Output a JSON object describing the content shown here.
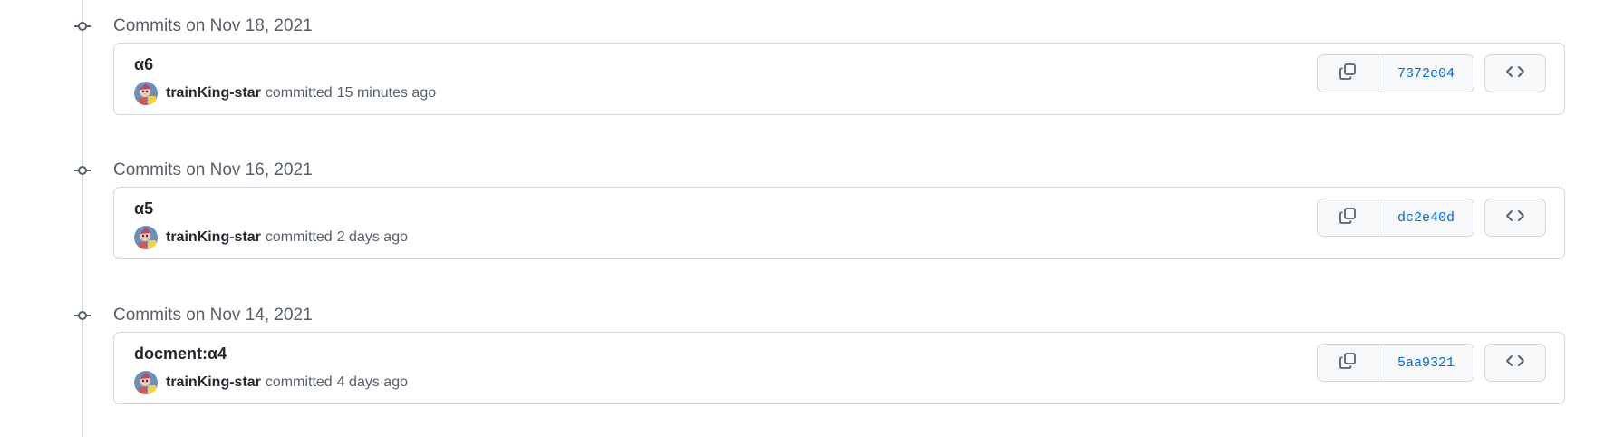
{
  "groups": [
    {
      "title": "Commits on Nov 18, 2021",
      "commit": {
        "message": "α6",
        "author": "trainKing-star",
        "action": "committed",
        "time": "15 minutes ago",
        "sha": "7372e04"
      }
    },
    {
      "title": "Commits on Nov 16, 2021",
      "commit": {
        "message": "α5",
        "author": "trainKing-star",
        "action": "committed",
        "time": "2 days ago",
        "sha": "dc2e40d"
      }
    },
    {
      "title": "Commits on Nov 14, 2021",
      "commit": {
        "message": "docment:α4",
        "author": "trainKing-star",
        "action": "committed",
        "time": "4 days ago",
        "sha": "5aa9321"
      }
    }
  ],
  "icons": {
    "node": "git-commit-icon",
    "copy": "copy-icon",
    "browse": "code-icon",
    "avatar": "avatar"
  },
  "colors": {
    "timeline": "#d0d7de",
    "sha_link": "#0969da",
    "muted_text": "#57606a",
    "border": "#d0d7de",
    "button_bg": "#f6f8fa"
  }
}
